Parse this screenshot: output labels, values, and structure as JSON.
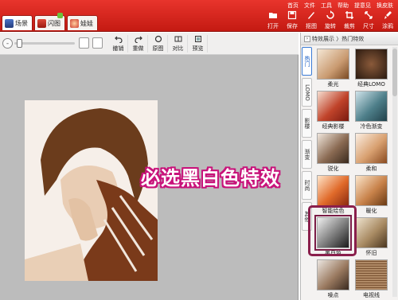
{
  "menubar": [
    "首页",
    "文件",
    "工具",
    "帮助",
    "提意见",
    "换皮肤"
  ],
  "mode_tabs": [
    {
      "label": "场景",
      "icon": "scene-icon"
    },
    {
      "label": "闪图",
      "icon": "flash-icon"
    },
    {
      "label": "娃娃",
      "icon": "doll-icon"
    }
  ],
  "toolbar": [
    {
      "label": "打开",
      "icon": "open-folder-icon"
    },
    {
      "label": "保存",
      "icon": "save-icon"
    },
    {
      "label": "抠图",
      "icon": "cutout-icon"
    },
    {
      "label": "旋转",
      "icon": "rotate-icon"
    },
    {
      "label": "裁剪",
      "icon": "crop-icon"
    },
    {
      "label": "尺寸",
      "icon": "resize-icon"
    },
    {
      "label": "涂鸦",
      "icon": "brush-icon"
    }
  ],
  "edit_buttons": [
    {
      "label": "撤销",
      "icon": "undo-icon"
    },
    {
      "label": "重做",
      "icon": "redo-icon"
    },
    {
      "label": "原图",
      "icon": "original-icon"
    },
    {
      "label": "对比",
      "icon": "compare-icon"
    },
    {
      "label": "预览",
      "icon": "preview-icon"
    }
  ],
  "panel": {
    "breadcrumb": "特效展示 〉热门特效",
    "vtabs": [
      "热门",
      "LOMO",
      "影楼",
      "渐变",
      "时尚",
      "其他"
    ],
    "effects": [
      "柔光",
      "经典LOMO",
      "经典影楼",
      "冷色渐变",
      "锐化",
      "柔和",
      "智能绘色",
      "暖化",
      "黑白色",
      "怀旧",
      "噪点",
      "电视线"
    ],
    "selected": "黑白色"
  },
  "annotation": "必选黑白色特效",
  "colors": {
    "title_red": "#d8261d",
    "highlight": "#8a1f4c",
    "annotation_outline": "#c8127a"
  }
}
